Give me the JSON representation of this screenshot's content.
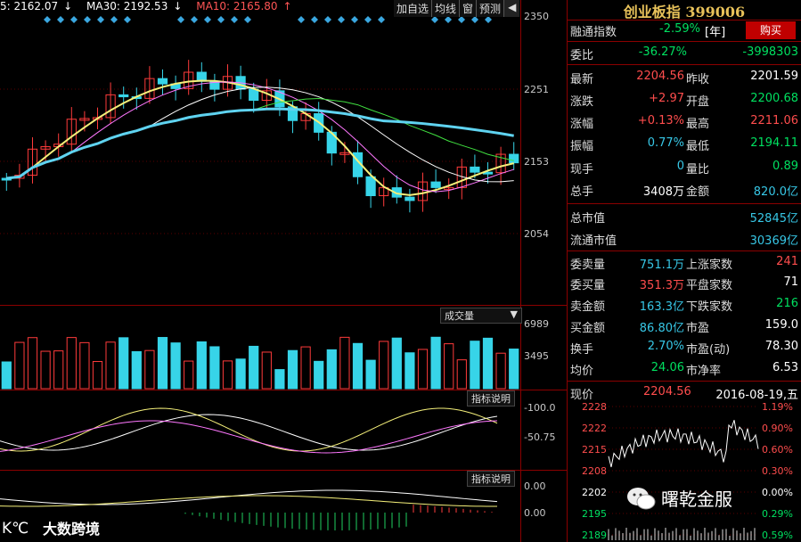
{
  "ma_legend": {
    "ma5": "5: 2162.07",
    "ma30": "MA30: 2192.53",
    "ma10": "MA10: 2165.80",
    "arrow_down": "↓",
    "arrow_up": "↑"
  },
  "toolbar": {
    "add_self": "加自选",
    "ma_line": "均线",
    "window": "窗",
    "forecast": "预测",
    "collapse": "◀"
  },
  "price_axis": [
    "2350",
    "2251",
    "2153",
    "2054"
  ],
  "volume_axis": [
    "6989",
    "3495"
  ],
  "volume_header": "成交量",
  "indicator1": {
    "header": "指标说明",
    "axis": [
      "100.0",
      "50.75"
    ]
  },
  "indicator2": {
    "header": "指标说明",
    "axis": [
      "0.00",
      "0.00"
    ]
  },
  "index": {
    "name": "创业板指",
    "code": "399006"
  },
  "quote": {
    "hk_flow_label": "融通指数",
    "hk_flow_value": "-2.59%",
    "hk_flow_unit": "[年]",
    "buy_label": "购买",
    "weibi_label": "委比",
    "weibi_pct": "-36.27%",
    "weibi_val": "-3998303",
    "latest_label": "最新",
    "latest": "2204.56",
    "prev_label": "昨收",
    "prev": "2201.59",
    "chg_label": "涨跌",
    "chg": "+2.97",
    "open_label": "开盘",
    "open": "2200.68",
    "pct_label": "涨幅",
    "pct": "+0.13%",
    "high_label": "最高",
    "high": "2211.06",
    "amp_label": "振幅",
    "amp": "0.77%",
    "low_label": "最低",
    "low": "2194.11",
    "cur_vol_label": "现手",
    "cur_vol": "0",
    "vol_ratio_label": "量比",
    "vol_ratio": "0.89",
    "tot_vol_label": "总手",
    "tot_vol": "3408万",
    "amount_label": "金额",
    "amount": "820.0亿",
    "mcap_label": "总市值",
    "mcap": "52845亿",
    "float_label": "流通市值",
    "float": "30369亿",
    "ask_vol_label": "委卖量",
    "ask_vol": "751.1万",
    "up_label": "上涨家数",
    "up": "241",
    "bid_vol_label": "委买量",
    "bid_vol": "351.3万",
    "flat_label": "平盘家数",
    "flat": "71",
    "ask_amt_label": "卖金额",
    "ask_amt": "163.3亿",
    "down_label": "下跌家数",
    "down": "216",
    "bid_amt_label": "买金额",
    "bid_amt": "86.80亿",
    "pe_label": "市盈",
    "pe": "159.0",
    "turn_label": "换手",
    "turn": "2.70%",
    "pe_dyn_label": "市盈(动)",
    "pe_dyn": "78.30",
    "avg_label": "均价",
    "avg": "24.06",
    "pb_label": "市净率",
    "pb": "6.53"
  },
  "mini": {
    "price_label": "现价",
    "price": "2204.56",
    "date": "2016-08-19,五",
    "left_axis": [
      "2228",
      "2222",
      "2215",
      "2208",
      "2202",
      "2195",
      "2189"
    ],
    "right_axis": [
      "1.19%",
      "0.90%",
      "0.60%",
      "0.30%",
      "0.00%",
      "0.29%",
      "0.59%"
    ]
  },
  "watermarks": {
    "left": "大数跨境",
    "right": "曙乾金服"
  }
}
